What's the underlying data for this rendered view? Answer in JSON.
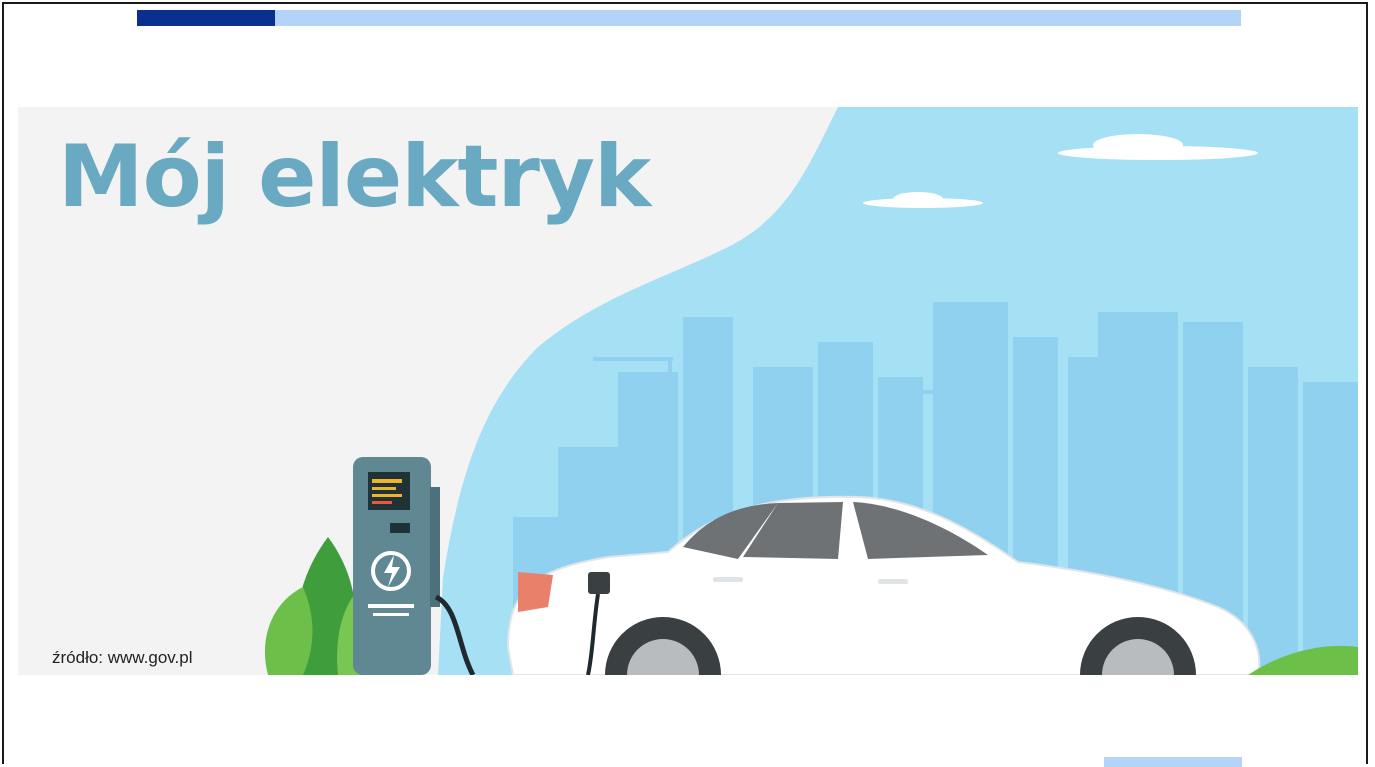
{
  "slide": {
    "title": "Mój elektryk",
    "source": "źródło: www.gov.pl"
  },
  "colors": {
    "accent_dark": "#0a2f8f",
    "accent_light": "#b3d4f7",
    "title": "#6aa9c2",
    "sky": "#9fdcf3"
  },
  "icons": [
    "charging-station-icon",
    "lightning-icon",
    "car-icon",
    "plant-icon",
    "cloud-icon"
  ]
}
